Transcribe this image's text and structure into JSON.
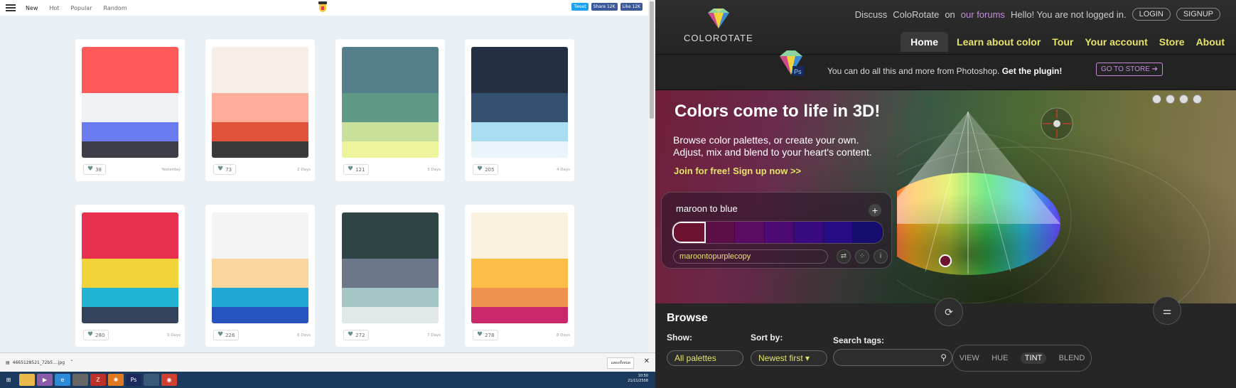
{
  "left": {
    "nav": {
      "items": [
        "New",
        "Hot",
        "Popular",
        "Random"
      ],
      "active": "New"
    },
    "share": {
      "tweet": "Tweet",
      "fb_share": "Share 12K",
      "fb_like": "Like 12K"
    },
    "cards": [
      {
        "colors": [
          "#ff5a5a",
          "#eef2f5",
          "#6b7bf0",
          "#3d3e47"
        ],
        "likes": "38",
        "when": "Yesterday"
      },
      {
        "colors": [
          "#f7efe7",
          "#ffad9a",
          "#e0523a",
          "#3a3a3a"
        ],
        "likes": "73",
        "when": "2 Days"
      },
      {
        "colors": [
          "#547f8a",
          "#5e9a86",
          "#c8e09a",
          "#eef49c"
        ],
        "likes": "121",
        "when": "3 Days"
      },
      {
        "colors": [
          "#222f43",
          "#36506f",
          "#a9ddf0",
          "#e9f5fa"
        ],
        "likes": "205",
        "when": "4 Days"
      },
      {
        "colors": [
          "#e9304f",
          "#f2d33a",
          "#21b3d4",
          "#34425c"
        ],
        "likes": "280",
        "when": "5 Days"
      },
      {
        "colors": [
          "#f4f4f4",
          "#fad59e",
          "#20a7d4",
          "#2753be"
        ],
        "likes": "226",
        "when": "6 Days"
      },
      {
        "colors": [
          "#2f4545",
          "#6c7889",
          "#a4c6c5",
          "#dfe7e8"
        ],
        "likes": "272",
        "when": "7 Days"
      },
      {
        "colors": [
          "#fbf1df",
          "#fbbd45",
          "#ec924e",
          "#c9286a"
        ],
        "likes": "278",
        "when": "8 Days"
      }
    ],
    "download": {
      "file": "4665128521_72b5....jpg",
      "show_all": "แสดงทั้งหมด"
    },
    "tray": {
      "time": "10:50",
      "date": "21/11/2558"
    }
  },
  "right": {
    "logo": "COLOROTATE",
    "top": {
      "discuss": "Discuss",
      "app": "ColoRotate",
      "on": "on",
      "forums": "our forums",
      "hello": "Hello! You are not logged in.",
      "login": "LOGIN",
      "signup": "SIGNUP"
    },
    "nav": [
      "Home",
      "Learn about color",
      "Tour",
      "Your account",
      "Store",
      "About"
    ],
    "plugin": {
      "text": "You can do all this and more from Photoshop.",
      "bold": "Get the plugin!",
      "store": "GO TO STORE"
    },
    "hero": {
      "title": "Colors come to life in 3D!",
      "line1": "Browse color palettes, or create your own.",
      "line2": "Adjust, mix and blend to your heart's content.",
      "join": "Join for free! Sign up now >>"
    },
    "palette": {
      "name": "maroon to blue",
      "tag": "maroontopurplecopy",
      "colors": [
        "#6e1232",
        "#5c0f47",
        "#5a0c62",
        "#4e0a75",
        "#3a0a80",
        "#260c84",
        "#150c6e"
      ]
    },
    "browse": {
      "title": "Browse",
      "show_label": "Show:",
      "show_value": "All palettes",
      "sort_label": "Sort by:",
      "sort_value": "Newest first",
      "search_label": "Search tags:",
      "modes": [
        "VIEW",
        "HUE",
        "TINT",
        "BLEND"
      ],
      "active_mode": "TINT"
    }
  }
}
